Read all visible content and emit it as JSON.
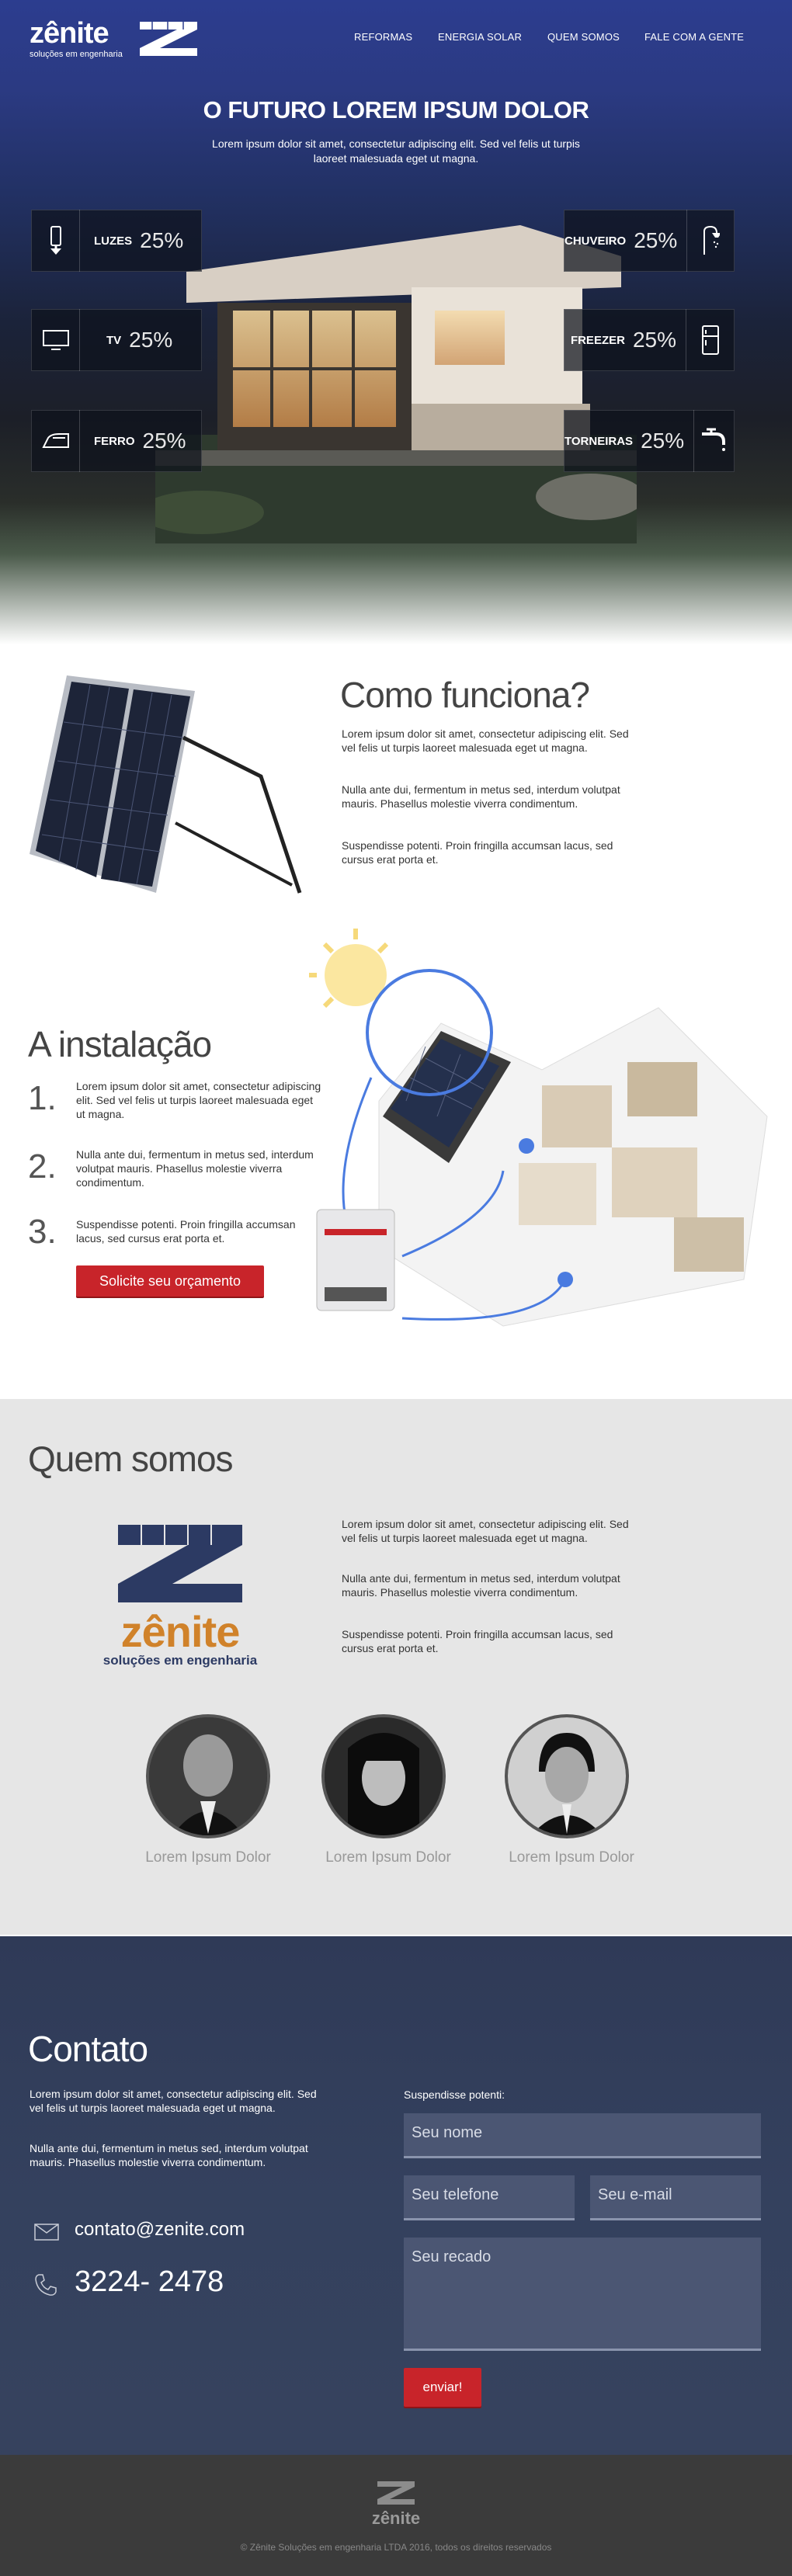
{
  "brand": {
    "name": "zênite",
    "tagline": "soluções em engenharia"
  },
  "nav": {
    "items": [
      "REFORMAS",
      "ENERGIA SOLAR",
      "QUEM SOMOS",
      "FALE COM A GENTE"
    ]
  },
  "hero": {
    "title": "O FUTURO LOREM IPSUM DOLOR",
    "subtitle": "Lorem ipsum dolor sit amet, consectetur adipiscing elit. Sed vel felis ut turpis laoreet malesuada eget ut magna.",
    "stats_left": [
      {
        "label": "LUZES",
        "value": "25%",
        "icon": "lightbulb-icon"
      },
      {
        "label": "TV",
        "value": "25%",
        "icon": "tv-icon"
      },
      {
        "label": "FERRO",
        "value": "25%",
        "icon": "iron-icon"
      }
    ],
    "stats_right": [
      {
        "label": "CHUVEIRO",
        "value": "25%",
        "icon": "shower-icon"
      },
      {
        "label": "FREEZER",
        "value": "25%",
        "icon": "fridge-icon"
      },
      {
        "label": "TORNEIRAS",
        "value": "25%",
        "icon": "faucet-icon"
      }
    ]
  },
  "como": {
    "title": "Como funciona?",
    "paragraphs": [
      "Lorem ipsum dolor sit amet, consectetur adipiscing elit. Sed vel felis ut turpis laoreet malesuada eget ut magna.",
      "Nulla ante dui, fermentum in metus sed, interdum volutpat mauris. Phasellus molestie viverra condimentum.",
      "Suspendisse potenti. Proin fringilla accumsan lacus, sed cursus erat porta et."
    ]
  },
  "instalacao": {
    "title": "A instalação",
    "steps": [
      {
        "num": "1.",
        "text": "Lorem ipsum dolor sit amet, consectetur adipiscing elit. Sed vel felis ut turpis laoreet malesuada eget ut magna."
      },
      {
        "num": "2.",
        "text": "Nulla ante dui, fermentum in metus sed, interdum volutpat mauris. Phasellus molestie viverra condimentum."
      },
      {
        "num": "3.",
        "text": "Suspendisse potenti. Proin fringilla accumsan lacus, sed cursus erat porta et."
      }
    ],
    "cta": "Solicite seu orçamento"
  },
  "quem": {
    "title": "Quem somos",
    "paragraphs": [
      "Lorem ipsum dolor sit amet, consectetur adipiscing elit. Sed vel felis ut turpis laoreet malesuada eget ut magna.",
      "Nulla ante dui, fermentum in metus sed, interdum volutpat mauris. Phasellus molestie viverra condimentum.",
      "Suspendisse potenti. Proin fringilla accumsan lacus, sed cursus erat porta et."
    ],
    "team": [
      "Lorem Ipsum Dolor",
      "Lorem Ipsum Dolor",
      "Lorem Ipsum Dolor"
    ]
  },
  "contato": {
    "title": "Contato",
    "paragraphs": [
      "Lorem ipsum dolor sit amet, consectetur adipiscing elit. Sed vel felis ut turpis laoreet malesuada eget ut magna.",
      "Nulla ante dui, fermentum in metus sed, interdum volutpat mauris. Phasellus molestie viverra condimentum."
    ],
    "email": "contato@zenite.com",
    "phone": "3224- 2478",
    "form_label": "Suspendisse potenti:",
    "fields": {
      "name": "Seu nome",
      "phone": "Seu telefone",
      "email": "Seu e-mail",
      "message": "Seu recado"
    },
    "submit": "enviar!"
  },
  "footer": {
    "copyright": "© Zênite Soluções em engenharia LTDA 2016, todos os direitos reservados"
  },
  "colors": {
    "accent": "#c8242a",
    "hero_blue": "#2c3d8f",
    "contact_bg": "#34415e",
    "logo_orange": "#d0822a",
    "logo_navy": "#2c3a63"
  }
}
